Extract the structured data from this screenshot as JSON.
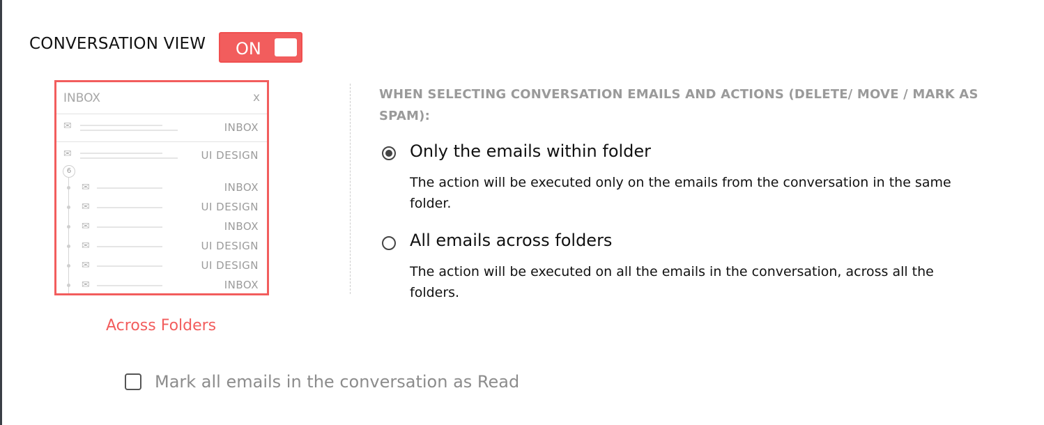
{
  "conversation_view": {
    "label": "CONVERSATION VIEW",
    "toggle_state": "ON",
    "enabled": true
  },
  "preview": {
    "header_title": "INBOX",
    "close_glyph": "x",
    "top_rows": [
      {
        "folder": "INBOX"
      },
      {
        "folder": "UI DESIGN"
      }
    ],
    "thread_count": "6",
    "thread_rows": [
      {
        "folder": "INBOX"
      },
      {
        "folder": "UI DESIGN"
      },
      {
        "folder": "INBOX"
      },
      {
        "folder": "UI DESIGN"
      },
      {
        "folder": "UI DESIGN"
      },
      {
        "folder": "INBOX"
      }
    ],
    "caption": "Across Folders"
  },
  "options": {
    "heading": "WHEN SELECTING CONVERSATION EMAILS AND ACTIONS (DELETE/ MOVE / MARK AS SPAM):",
    "items": [
      {
        "label": "Only the emails within folder",
        "description": "The action will be executed only on the emails from the conversation in the same folder.",
        "selected": true
      },
      {
        "label": "All emails across folders",
        "description": "The action will be executed on all the emails in the conversation, across all the folders.",
        "selected": false
      }
    ]
  },
  "mark_read": {
    "label": "Mark all emails in the conversation as Read",
    "checked": false
  },
  "colors": {
    "accent": "#f25d5d",
    "muted_text": "#9a9a9a"
  },
  "icons": {
    "mail": "envelope-open-icon"
  }
}
